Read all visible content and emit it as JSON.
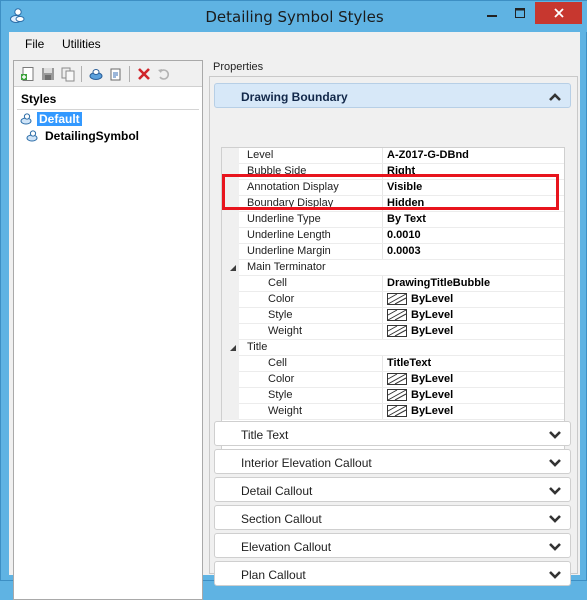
{
  "window": {
    "title": "Detailing Symbol Styles",
    "icon": "app-icon",
    "controls": [
      "minimize-icon",
      "maximize-icon",
      "close-icon"
    ],
    "close_color": "#c7372f"
  },
  "menu": [
    {
      "label": "File"
    },
    {
      "label": "Utilities"
    }
  ],
  "toolbar": {
    "tools": [
      "new-style-icon",
      "save-icon",
      "copy-icon",
      "import-icon",
      "export-icon",
      "delete-icon",
      "reset-icon"
    ]
  },
  "styles": {
    "header": "Styles",
    "items": [
      {
        "label": "Default",
        "selected": true
      },
      {
        "label": "DetailingSymbol",
        "selected": false
      }
    ]
  },
  "properties": {
    "label": "Properties",
    "groups": [
      {
        "title": "Drawing Boundary",
        "expanded": true,
        "rows": [
          {
            "name": "Level",
            "value": "A-Z017-G-DBnd"
          },
          {
            "name": "Bubble Side",
            "value": "Right"
          },
          {
            "name": "Annotation Display",
            "value": "Visible"
          },
          {
            "name": "Boundary Display",
            "value": "Hidden"
          },
          {
            "name": "Underline Type",
            "value": "By Text"
          },
          {
            "name": "Underline Length",
            "value": "0.0010"
          },
          {
            "name": "Underline Margin",
            "value": "0.0003"
          },
          {
            "name": "Main Terminator",
            "value": "",
            "category": true
          },
          {
            "name": "Cell",
            "value": "DrawingTitleBubble"
          },
          {
            "name": "Color",
            "value": "ByLevel",
            "swatch": true
          },
          {
            "name": "Style",
            "value": "ByLevel",
            "swatch": true
          },
          {
            "name": "Weight",
            "value": "ByLevel",
            "swatch": true
          },
          {
            "name": "Title",
            "value": "",
            "category": true
          },
          {
            "name": "Cell",
            "value": "TitleText"
          },
          {
            "name": "Color",
            "value": "ByLevel",
            "swatch": true
          },
          {
            "name": "Style",
            "value": "ByLevel",
            "swatch": true
          },
          {
            "name": "Weight",
            "value": "ByLevel",
            "swatch": true
          }
        ]
      },
      {
        "title": "Title Text",
        "expanded": false
      },
      {
        "title": "Interior Elevation Callout",
        "expanded": false
      },
      {
        "title": "Detail Callout",
        "expanded": false
      },
      {
        "title": "Section Callout",
        "expanded": false
      },
      {
        "title": "Elevation Callout",
        "expanded": false
      },
      {
        "title": "Plan Callout",
        "expanded": false
      }
    ]
  },
  "highlight_color": "#e8141d",
  "accent": "#5fb3e3"
}
